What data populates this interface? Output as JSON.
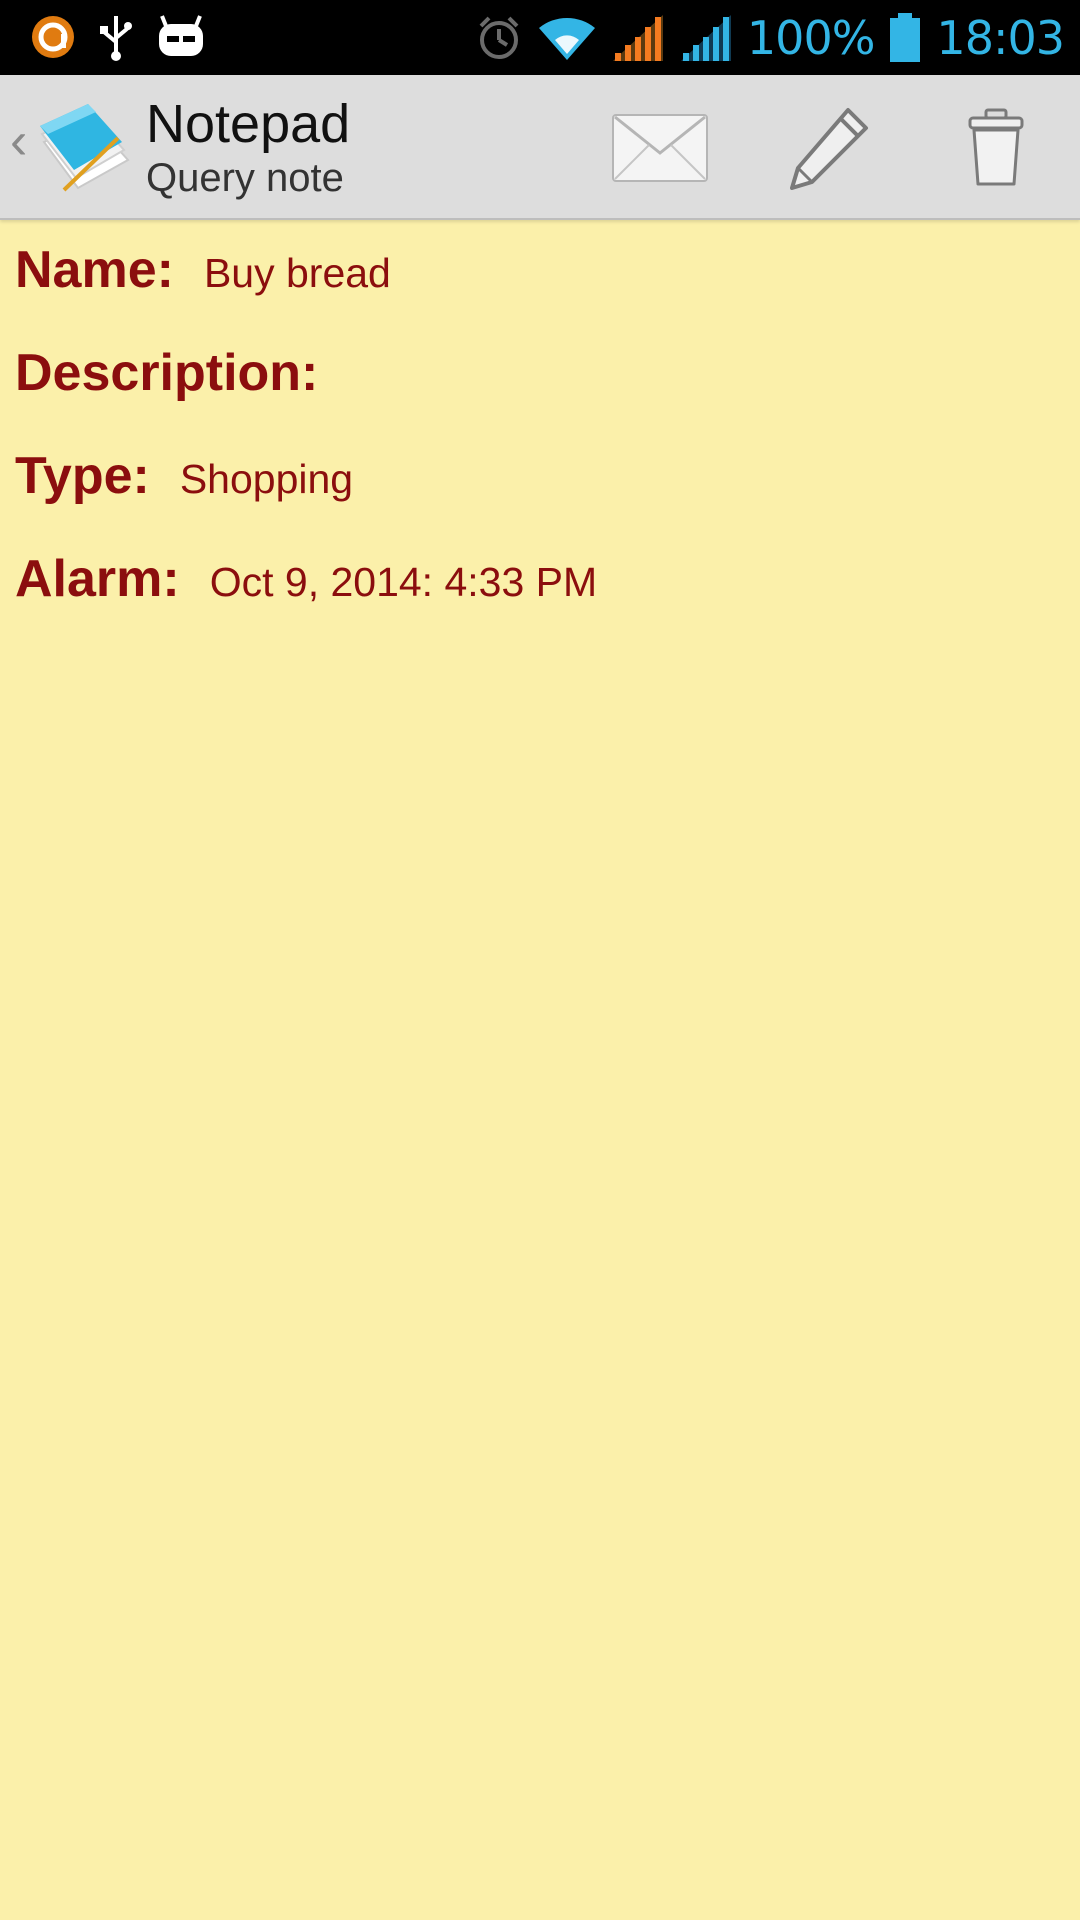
{
  "status_bar": {
    "battery_percent": "100%",
    "time": "18:03",
    "accent_color": "#33B5E5",
    "left_icons": [
      "avast-icon",
      "usb-icon",
      "cyanogenmod-icon"
    ],
    "right_icons": [
      "alarm-icon",
      "wifi-icon",
      "signal-orange-icon",
      "signal-blue-icon",
      "battery-icon"
    ]
  },
  "action_bar": {
    "title": "Notepad",
    "subtitle": "Query note",
    "actions": [
      "mail-icon",
      "pencil-icon",
      "trash-icon"
    ]
  },
  "note": {
    "name_label": "Name:",
    "name_value": "Buy bread",
    "description_label": "Description:",
    "description_value": "",
    "type_label": "Type:",
    "type_value": "Shopping",
    "alarm_label": "Alarm:",
    "alarm_value": "Oct 9, 2014: 4:33 PM"
  },
  "colors": {
    "background": "#FBF0AA",
    "text": "#8B0E0E",
    "action_bar": "#DDDDDD"
  }
}
